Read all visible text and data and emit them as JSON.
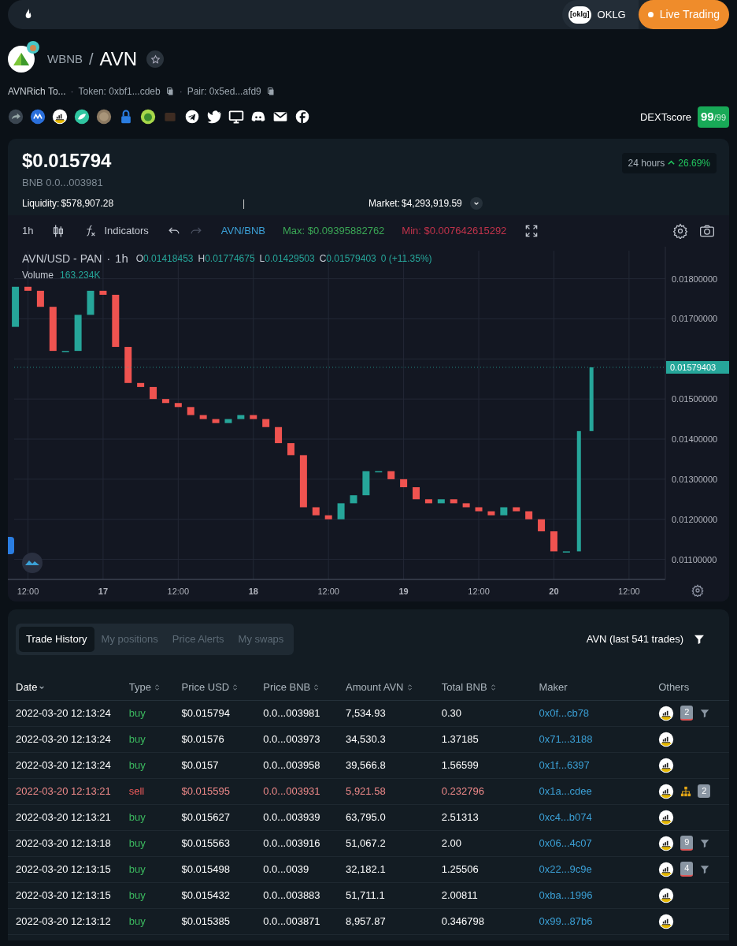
{
  "top_bar": {
    "partner_logo": "[oklg]",
    "partner": "OKLG",
    "live_button": "Live Trading"
  },
  "pair": {
    "base": "WBNB",
    "separator": "/",
    "quote": "AVN",
    "name": "AVNRich To...",
    "dot_1": "·",
    "token": "Token: 0xbf1...cdeb",
    "dot_2": "·",
    "pair": "Pair: 0x5ed...afd9",
    "score_label": "DEXTscore",
    "score": "99",
    "score_max": "/99"
  },
  "price": {
    "usd": "$0.015794",
    "bnb": "BNB 0.0...003981",
    "period": "24 hours",
    "change": "26.69%",
    "rising": true,
    "liquidity_label": "Liquidity:",
    "liquidity": "$578,907.28",
    "divider": "|",
    "market_label": "Market:",
    "market": "$4,293,919.59"
  },
  "chart_toolbar": {
    "interval": "1h",
    "indicators": "Indicators",
    "pair": "AVN/BNB",
    "max": "Max: $0.09395882762",
    "min": "Min: $0.007642615292"
  },
  "chart_legend": {
    "symbol": "AVN/USD - PAN",
    "dot": "·",
    "interval": "1h",
    "open_label": "O",
    "open": "0.01418453",
    "high_label": "H",
    "high": "0.01774675",
    "low_label": "L",
    "low": "0.01429503",
    "close_label": "C",
    "close": "0.01579403",
    "change": "0 (+11.35%)",
    "volume_label": "Volume",
    "volume": "163.234K",
    "last_price_tag": "0.01579403"
  },
  "chart_axes": {
    "x_labels": [
      "12:00",
      "17",
      "12:00",
      "18",
      "12:00",
      "19",
      "12:00",
      "20",
      "12:00"
    ],
    "y_labels": [
      "0.01800000",
      "0.01700000",
      "0.01500000",
      "0.01400000",
      "0.01300000",
      "0.01200000",
      "0.01100000"
    ]
  },
  "tabs": [
    {
      "label": "Trade History",
      "selected": true
    },
    {
      "label": "My positions",
      "selected": false
    },
    {
      "label": "Price Alerts",
      "selected": false
    },
    {
      "label": "My swaps",
      "selected": false
    }
  ],
  "trades_summary": "AVN (last 541 trades)",
  "table": {
    "columns": [
      {
        "label": "Date",
        "sorted": true,
        "sortable": true
      },
      {
        "label": "Type",
        "sorted": false,
        "sortable": true
      },
      {
        "label": "Price USD",
        "sorted": false,
        "sortable": true
      },
      {
        "label": "Price BNB",
        "sorted": false,
        "sortable": true
      },
      {
        "label": "Amount AVN",
        "sorted": false,
        "sortable": true
      },
      {
        "label": "Total BNB",
        "sorted": false,
        "sortable": true
      },
      {
        "label": "Maker",
        "sorted": false,
        "sortable": false
      },
      {
        "label": "Others",
        "sorted": false,
        "sortable": false
      }
    ],
    "rows": [
      {
        "date": "2022-03-20 12:13:24",
        "side": "buy",
        "price_usd": "$0.015794",
        "price_bnb": "0.0...003981",
        "amount": "7,534.93",
        "total": "0.30",
        "maker": "0x0f...cb78",
        "badge": "2",
        "filter": true,
        "tree": false
      },
      {
        "date": "2022-03-20 12:13:24",
        "side": "buy",
        "price_usd": "$0.01576",
        "price_bnb": "0.0...003973",
        "amount": "34,530.3",
        "total": "1.37185",
        "maker": "0x71...3188",
        "filter": false,
        "tree": false
      },
      {
        "date": "2022-03-20 12:13:24",
        "side": "buy",
        "price_usd": "$0.0157",
        "price_bnb": "0.0...003958",
        "amount": "39,566.8",
        "total": "1.56599",
        "maker": "0x1f...6397",
        "filter": false,
        "tree": false
      },
      {
        "date": "2022-03-20 12:13:21",
        "side": "sell",
        "price_usd": "$0.015595",
        "price_bnb": "0.0...003931",
        "amount": "5,921.58",
        "total": "0.232796",
        "maker": "0x1a...cdee",
        "badge": "2",
        "filter": false,
        "tree": true
      },
      {
        "date": "2022-03-20 12:13:21",
        "side": "buy",
        "price_usd": "$0.015627",
        "price_bnb": "0.0...003939",
        "amount": "63,795.0",
        "total": "2.51313",
        "maker": "0xc4...b074",
        "filter": false,
        "tree": false
      },
      {
        "date": "2022-03-20 12:13:18",
        "side": "buy",
        "price_usd": "$0.015563",
        "price_bnb": "0.0...003916",
        "amount": "51,067.2",
        "total": "2.00",
        "maker": "0x06...4c07",
        "badge": "9",
        "filter": true,
        "tree": false
      },
      {
        "date": "2022-03-20 12:13:15",
        "side": "buy",
        "price_usd": "$0.015498",
        "price_bnb": "0.0...0039",
        "amount": "32,182.1",
        "total": "1.25506",
        "maker": "0x22...9c9e",
        "badge": "4",
        "filter": true,
        "tree": false
      },
      {
        "date": "2022-03-20 12:13:15",
        "side": "buy",
        "price_usd": "$0.015432",
        "price_bnb": "0.0...003883",
        "amount": "51,711.1",
        "total": "2.00811",
        "maker": "0xba...1996",
        "filter": false,
        "tree": false
      },
      {
        "date": "2022-03-20 12:13:12",
        "side": "buy",
        "price_usd": "$0.015385",
        "price_bnb": "0.0...003871",
        "amount": "8,957.87",
        "total": "0.346798",
        "maker": "0x99...87b6",
        "filter": false,
        "tree": false
      }
    ]
  }
}
